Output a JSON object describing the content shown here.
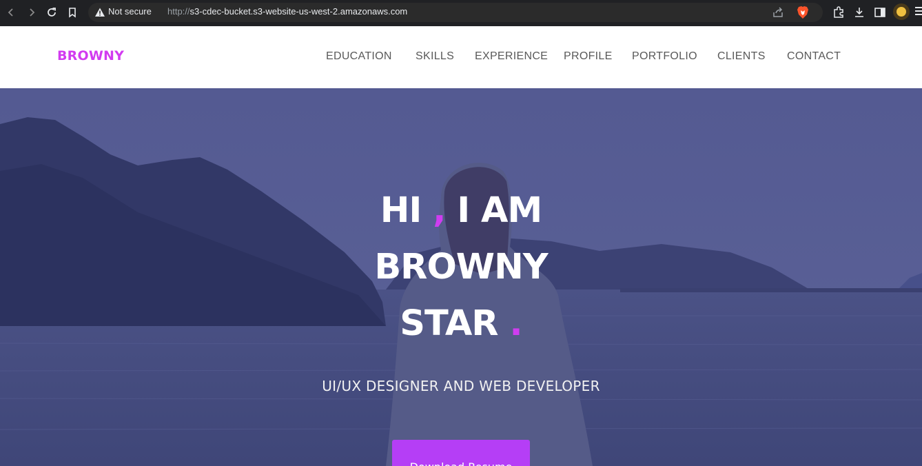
{
  "browser": {
    "security_label": "Not secure",
    "url_protocol": "http://",
    "url_host": "s3-cdec-bucket.s3-website-us-west-2.amazonaws.com"
  },
  "site": {
    "brand": "BROWNY",
    "brand_color": "#d23bf0",
    "nav": [
      "EDUCATION",
      "SKILLS",
      "EXPERIENCE",
      "PROFILE",
      "PORTFOLIO",
      "CLIENTS",
      "CONTACT"
    ]
  },
  "hero": {
    "line1_a": "HI",
    "line1_comma": " ,",
    "line1_b": " I AM",
    "line2": "BROWNY",
    "line3": "STAR",
    "line3_dot": " .",
    "subtitle": "UI/UX DESIGNER AND WEB DEVELOPER",
    "button_label": "Download Resume",
    "accent_color": "#cf3df0",
    "button_color": "#b53ef6"
  }
}
